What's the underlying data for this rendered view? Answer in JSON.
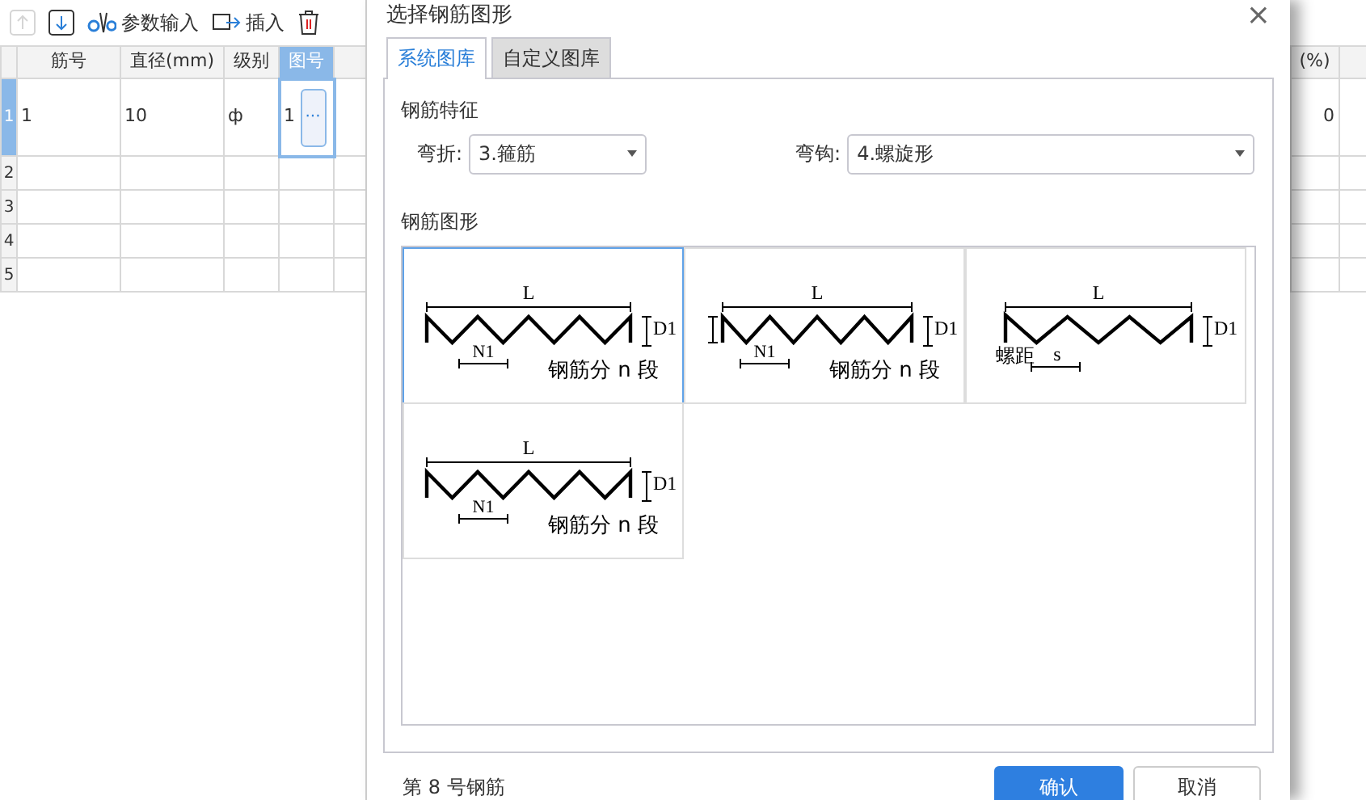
{
  "toolbar": [
    {
      "kind": "up",
      "disabled": true
    },
    {
      "kind": "down",
      "disabled": false
    },
    {
      "kind": "param",
      "label": "参数输入",
      "disabled": false
    },
    {
      "kind": "insert",
      "label": "插入",
      "disabled": false
    },
    {
      "kind": "delete",
      "disabled": false
    }
  ],
  "table": {
    "columns": [
      "筋号",
      "直径(mm)",
      "级别",
      "图号"
    ],
    "rows": [
      {
        "index": "1",
        "selected": true,
        "cells": [
          "1",
          "10",
          "ф",
          "1"
        ]
      },
      {
        "index": "2",
        "selected": false,
        "cells": [
          "",
          "",
          "",
          ""
        ]
      },
      {
        "index": "3",
        "selected": false,
        "cells": [
          "",
          "",
          "",
          ""
        ]
      },
      {
        "index": "4",
        "selected": false,
        "cells": [
          "",
          "",
          "",
          ""
        ]
      },
      {
        "index": "5",
        "selected": false,
        "cells": [
          "",
          "",
          "",
          ""
        ]
      }
    ],
    "edit_button": "···",
    "right_columns": [
      "(%)"
    ],
    "right_rows": [
      "0"
    ]
  },
  "dialog": {
    "title": "选择钢筋图形",
    "close": "×",
    "tabs": [
      {
        "label": "系统图库",
        "selected": true
      },
      {
        "label": "自定义图库",
        "selected": false
      }
    ],
    "features_title": "钢筋特征",
    "fields": [
      {
        "label": "弯折:",
        "value": "3.箍筋"
      },
      {
        "label": "弯钩:",
        "value": "4.螺旋形"
      }
    ],
    "shapes_title": "钢筋图形",
    "shapes": [
      {
        "kind": "zigzag",
        "selected": true,
        "length": "L",
        "depth": "D1",
        "segment": "N1",
        "caption": "钢筋分 n 段"
      },
      {
        "kind": "zigzag-offset",
        "selected": false,
        "length": "L",
        "depth": "D1",
        "segment": "N1",
        "caption": "钢筋分 n 段"
      },
      {
        "kind": "spiral",
        "selected": false,
        "length": "L",
        "depth": "D1",
        "pitch_label": "螺距",
        "pitch": "s"
      },
      {
        "kind": "zigzag",
        "selected": false,
        "length": "L",
        "depth": "D1",
        "segment": "N1",
        "caption": "钢筋分 n 段"
      }
    ],
    "status": "第 8 号钢筋",
    "buttons": [
      {
        "kind": "primary",
        "label": "确认"
      },
      {
        "kind": "secondary",
        "label": "取消"
      }
    ]
  }
}
